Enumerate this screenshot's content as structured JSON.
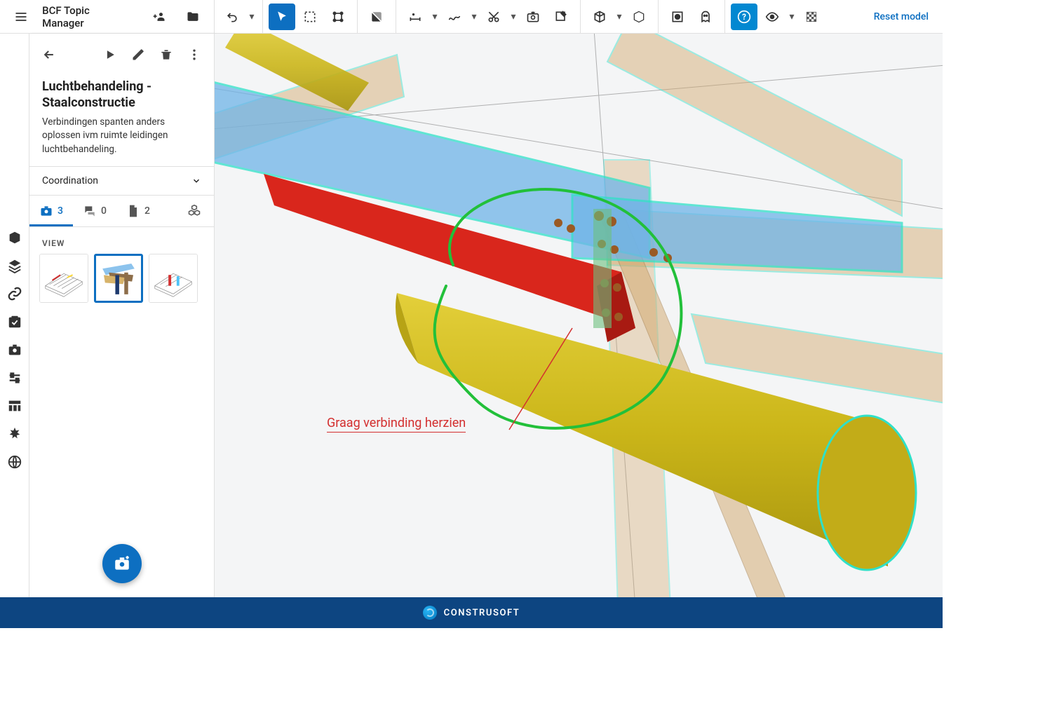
{
  "header": {
    "panel_title": "BCF Topic Manager",
    "reset_link": "Reset model"
  },
  "panel": {
    "topic_title": "Luchtbehandeling - Staalconstructie",
    "topic_desc": "Verbindingen spanten anders oplossen ivm ruimte leidingen luchtbehandeling.",
    "category": "Coordination",
    "tab_counts": {
      "views": "3",
      "comments": "0",
      "documents": "2"
    },
    "view_label": "VIEW"
  },
  "viewer": {
    "annotation": "Graag verbinding herzien"
  },
  "footer": {
    "brand": "CONSTRUSOFT"
  }
}
